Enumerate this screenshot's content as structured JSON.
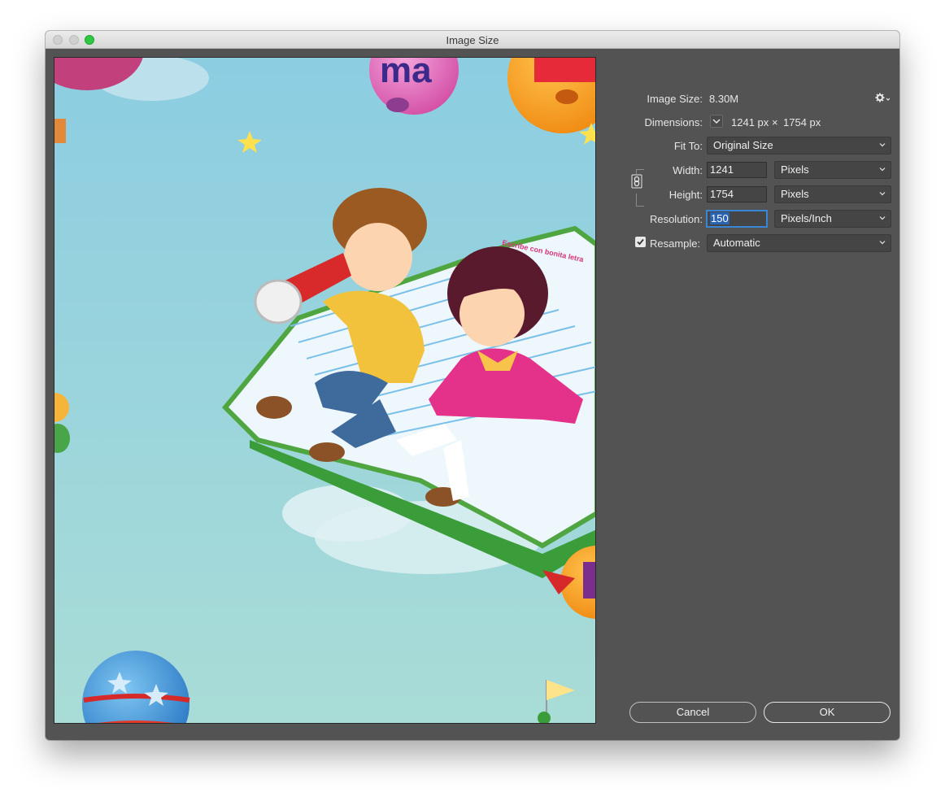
{
  "window": {
    "title": "Image Size"
  },
  "image_size": {
    "label": "Image Size:",
    "value": "8.30M"
  },
  "dimensions": {
    "label": "Dimensions:",
    "width_value": "1241 px",
    "times": "×",
    "height_value": "1754 px"
  },
  "fit_to": {
    "label": "Fit To:",
    "selected": "Original Size"
  },
  "width": {
    "label": "Width:",
    "value": "1241",
    "unit": "Pixels"
  },
  "height": {
    "label": "Height:",
    "value": "1754",
    "unit": "Pixels"
  },
  "resolution": {
    "label": "Resolution:",
    "value": "150",
    "unit": "Pixels/Inch"
  },
  "resample": {
    "label": "Resample:",
    "checked": true,
    "selected": "Automatic"
  },
  "buttons": {
    "cancel": "Cancel",
    "ok": "OK"
  },
  "preview": {
    "balloon_top_text": "ma",
    "book_text": "Escribe con bonita letra"
  },
  "colors": {
    "accent": "#3a86d6",
    "dialog_bg": "#535353",
    "sky": "#8fcde0"
  },
  "icons": [
    "gear-icon",
    "chevron-down-icon",
    "link-icon",
    "checkbox-check-icon"
  ]
}
